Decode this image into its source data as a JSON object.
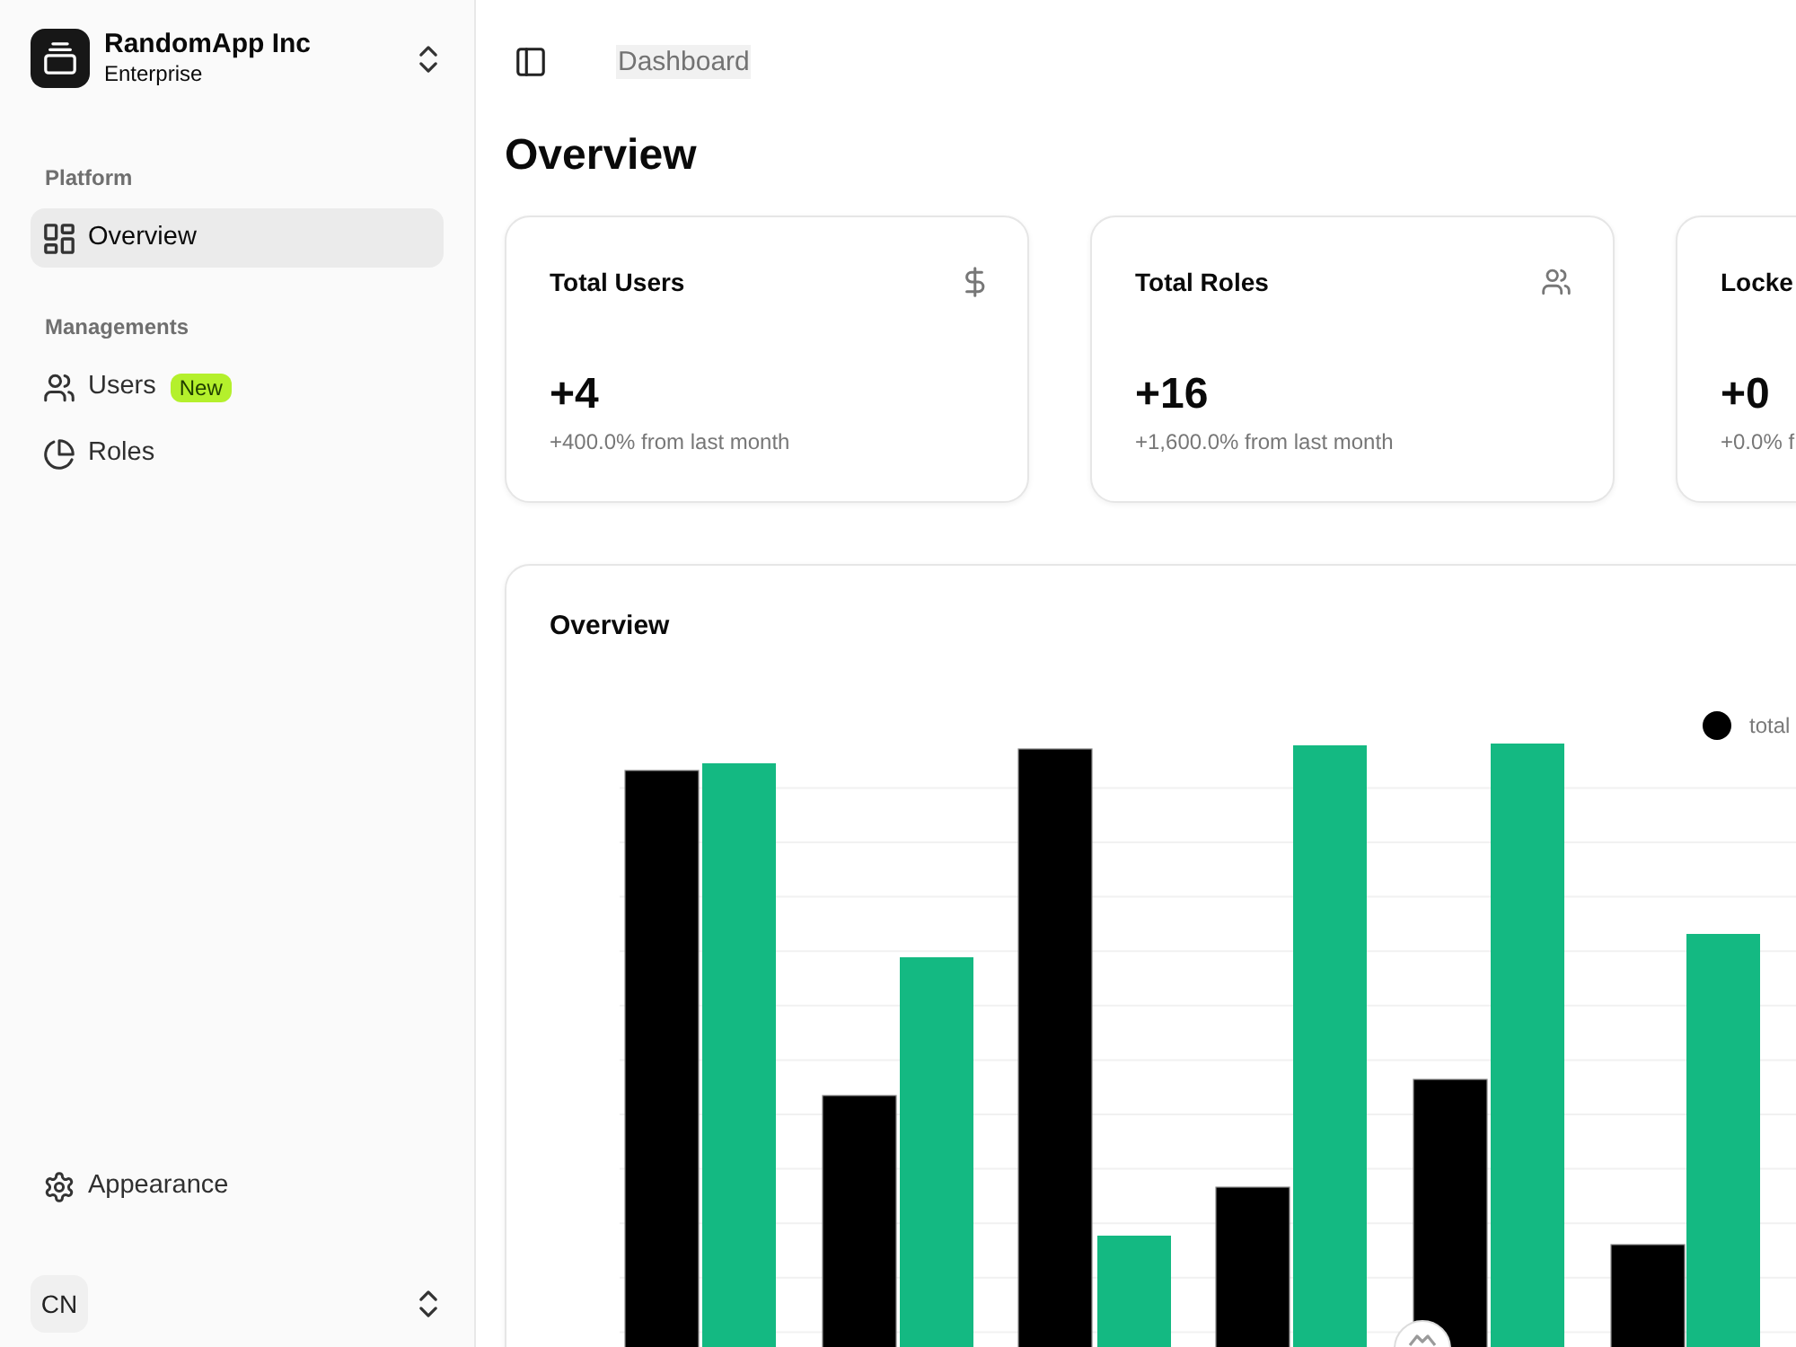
{
  "sidebar": {
    "team": {
      "name": "RandomApp Inc",
      "plan": "Enterprise"
    },
    "groups": [
      {
        "label": "Platform",
        "items": [
          {
            "label": "Overview",
            "selected": true
          }
        ]
      },
      {
        "label": "Managements",
        "items": [
          {
            "label": "Users",
            "selected": false,
            "badge": "New"
          },
          {
            "label": "Roles",
            "selected": false
          }
        ]
      }
    ],
    "footer_items": [
      {
        "label": "Appearance"
      }
    ],
    "user": {
      "avatar": "CN"
    }
  },
  "header": {
    "breadcrumb": "Dashboard"
  },
  "page_title": "Overview",
  "stats": [
    {
      "title": "Total Users",
      "value": "+4",
      "change": "+400.0% from last month"
    },
    {
      "title": "Total Roles",
      "value": "+16",
      "change": "+1,600.0% from last month"
    },
    {
      "title": "Locke",
      "value": "+0",
      "change": "+0.0% f"
    }
  ],
  "chart_card": {
    "title": "Overview",
    "legend": [
      {
        "label": "total",
        "color": "#000000"
      }
    ]
  }
}
